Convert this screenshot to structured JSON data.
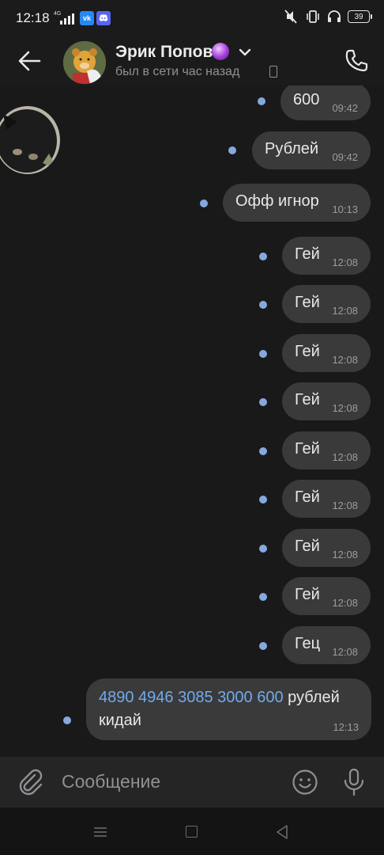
{
  "status_bar": {
    "time": "12:18",
    "network_tag": "4G",
    "vk_label": "vk",
    "battery": "39"
  },
  "header": {
    "name": "Эрик Попов",
    "status": "был в сети час назад"
  },
  "messages": [
    {
      "text": "600",
      "time": "09:42"
    },
    {
      "text": "Рублей",
      "time": "09:42"
    },
    {
      "text": "Офф игнор",
      "time": "10:13"
    },
    {
      "text": "Гей",
      "time": "12:08"
    },
    {
      "text": "Гей",
      "time": "12:08"
    },
    {
      "text": "Гей",
      "time": "12:08"
    },
    {
      "text": "Гей",
      "time": "12:08"
    },
    {
      "text": "Гей",
      "time": "12:08"
    },
    {
      "text": "Гей",
      "time": "12:08"
    },
    {
      "text": "Гей",
      "time": "12:08"
    },
    {
      "text": "Гей",
      "time": "12:08"
    },
    {
      "text": "Гец",
      "time": "12:08"
    }
  ],
  "last_message": {
    "card_number": "4890 4946 3085 3000",
    "amount": "600",
    "rest_line1": "рублей",
    "line2": "кидай",
    "time": "12:13"
  },
  "composer": {
    "placeholder": "Сообщение"
  },
  "colors": {
    "accent_link": "#71aaeb",
    "unread_dot": "#84a9dd",
    "bubble": "#3a3a3b",
    "background": "#19191a"
  }
}
